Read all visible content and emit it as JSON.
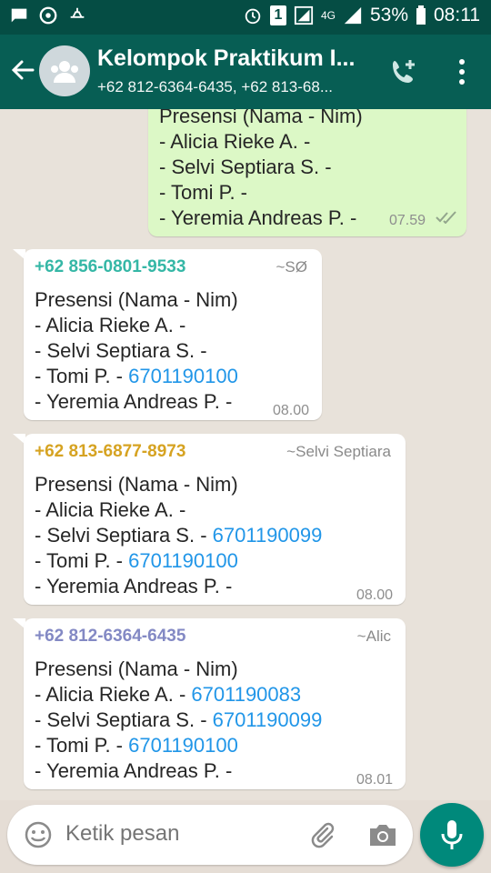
{
  "status_bar": {
    "battery": "53%",
    "time": "08:11",
    "sim_label": "1",
    "network": "4G"
  },
  "header": {
    "title": "Kelompok Praktikum I...",
    "subtitle": "+62 812-6364-6435, +62 813-68..."
  },
  "messages": [
    {
      "type": "outgoing",
      "lines": [
        "Presensi (Nama - Nim)",
        "- Alicia Rieke A. -",
        "- Selvi Septiara S. -",
        "- Tomi P. -",
        "- Yeremia Andreas P. -"
      ],
      "time": "07.59"
    },
    {
      "type": "incoming",
      "sender": "+62 856-0801-9533",
      "alias": "~SØ",
      "sender_color": "#35b7a6",
      "lines": [
        {
          "text": "Presensi (Nama - Nim)",
          "link": ""
        },
        {
          "text": "- Alicia Rieke A. -",
          "link": ""
        },
        {
          "text": "- Selvi Septiara S. -",
          "link": ""
        },
        {
          "text": "- Tomi P. -",
          "link": "6701190100"
        },
        {
          "text": "- Yeremia Andreas P. -",
          "link": ""
        }
      ],
      "time": "08.00"
    },
    {
      "type": "incoming",
      "sender": "+62 813-6877-8973",
      "alias": "~Selvi Septiara",
      "sender_color": "#d6a322",
      "lines": [
        {
          "text": "Presensi (Nama - Nim)",
          "link": ""
        },
        {
          "text": "- Alicia Rieke A. -",
          "link": ""
        },
        {
          "text": "- Selvi Septiara S. -",
          "link": "6701190099"
        },
        {
          "text": "- Tomi P. -",
          "link": "6701190100"
        },
        {
          "text": "- Yeremia Andreas P. -",
          "link": ""
        }
      ],
      "time": "08.00"
    },
    {
      "type": "incoming",
      "sender": "+62 812-6364-6435",
      "alias": "~Alic",
      "sender_color": "#8389c4",
      "lines": [
        {
          "text": "Presensi (Nama - Nim)",
          "link": ""
        },
        {
          "text": "- Alicia Rieke A. -",
          "link": "6701190083"
        },
        {
          "text": "- Selvi Septiara S. -",
          "link": "6701190099"
        },
        {
          "text": "- Tomi P. -",
          "link": "6701190100"
        },
        {
          "text": "- Yeremia Andreas P. -",
          "link": ""
        }
      ],
      "time": "08.01"
    }
  ],
  "input": {
    "placeholder": "Ketik pesan"
  },
  "colors": {
    "header": "#075e54",
    "status_bar": "#054d44",
    "outgoing_bubble": "#dcf8c6",
    "link": "#2196e8",
    "mic_button": "#00897b"
  },
  "icons": [
    "chat-notification-icon",
    "whatsapp-icon",
    "usb-icon",
    "alarm-icon",
    "sim-icon",
    "signal-icon",
    "battery-icon",
    "back-arrow-icon",
    "group-avatar-icon",
    "add-call-icon",
    "more-vert-icon",
    "double-check-icon",
    "emoji-icon",
    "attach-icon",
    "camera-icon",
    "mic-icon"
  ]
}
